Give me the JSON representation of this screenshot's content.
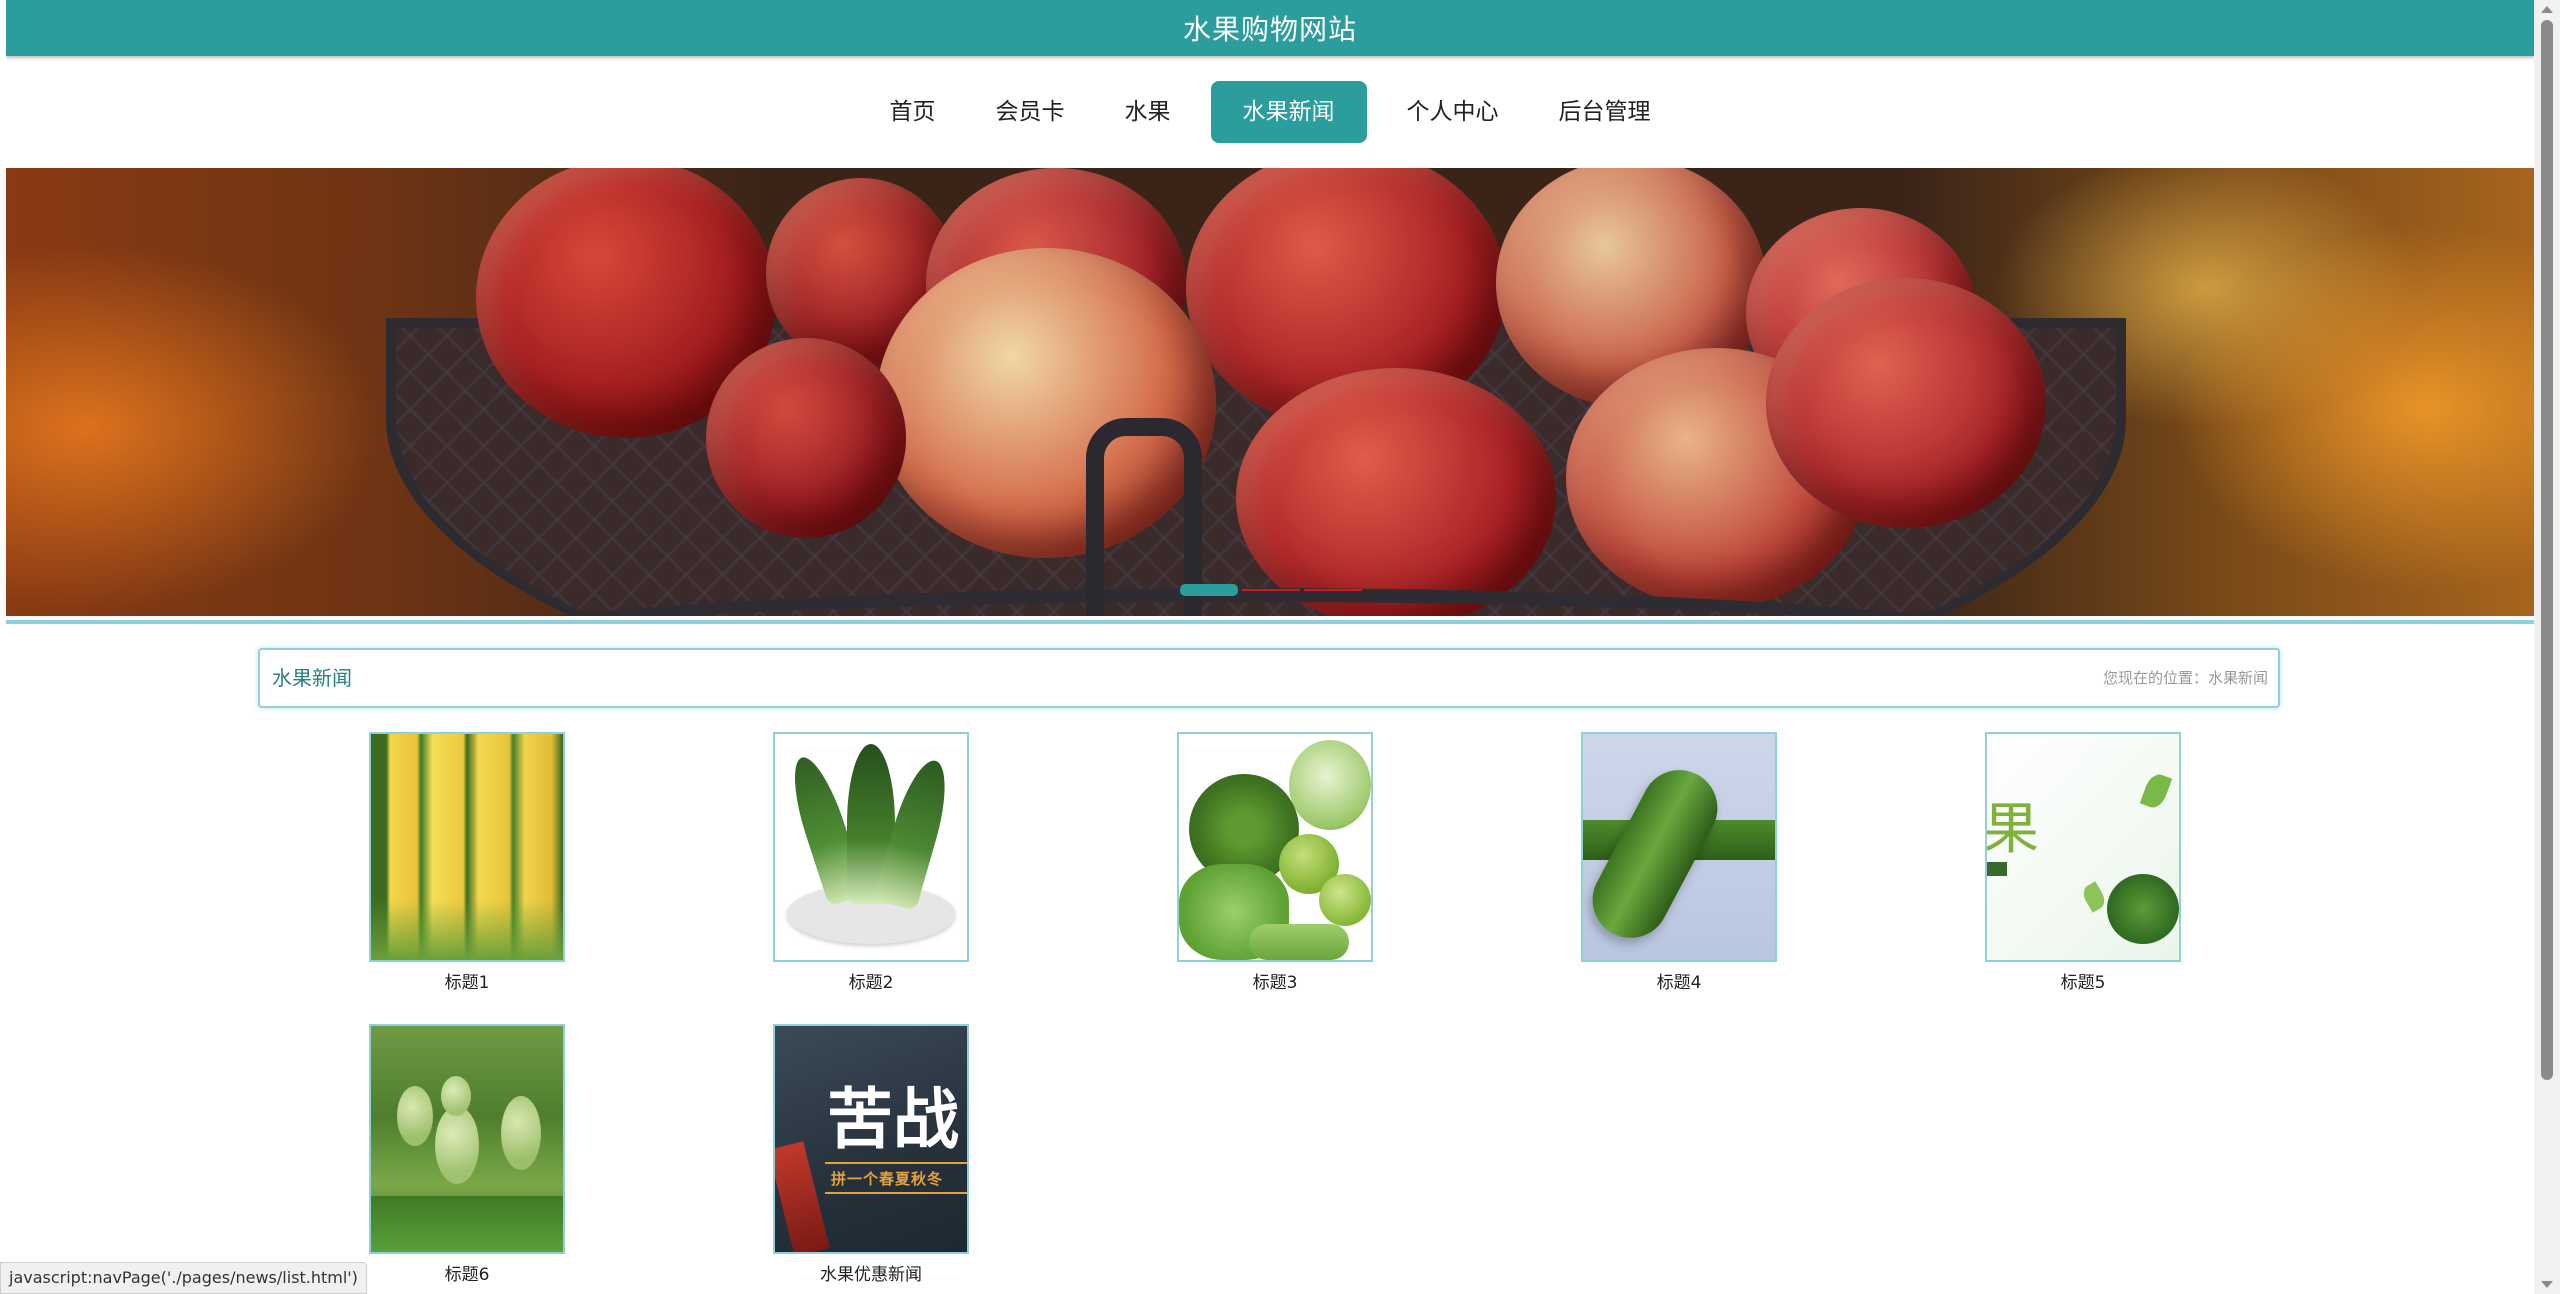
{
  "header": {
    "title": "水果购物网站"
  },
  "nav": {
    "items": [
      {
        "label": "首页"
      },
      {
        "label": "会员卡"
      },
      {
        "label": "水果"
      },
      {
        "label": "水果新闻",
        "active": true
      },
      {
        "label": "个人中心"
      },
      {
        "label": "后台管理"
      }
    ]
  },
  "banner": {
    "slides_count": 3,
    "active_slide": 1,
    "image": "apples-in-basket"
  },
  "section": {
    "title": "水果新闻",
    "breadcrumb": "您现在的位置：水果新闻"
  },
  "news": {
    "items": [
      {
        "title": "标题1",
        "thumb": "corn"
      },
      {
        "title": "标题2",
        "thumb": "bok-choy"
      },
      {
        "title": "标题3",
        "thumb": "green-vegetables"
      },
      {
        "title": "标题4",
        "thumb": "cucumber"
      },
      {
        "title": "标题5",
        "thumb": "green-poster"
      },
      {
        "title": "标题6",
        "thumb": "gourds"
      },
      {
        "title": "水果优惠新闻",
        "thumb": "promo-poster"
      }
    ],
    "poster5_char": "果",
    "poster7_text": "苦战",
    "poster7_sub": "拼一个春夏秋冬"
  },
  "status_bar": {
    "url": "javascript:navPage('./pages/news/list.html')"
  },
  "colors": {
    "accent": "#2a9d9c",
    "border": "#8fd0dc"
  }
}
